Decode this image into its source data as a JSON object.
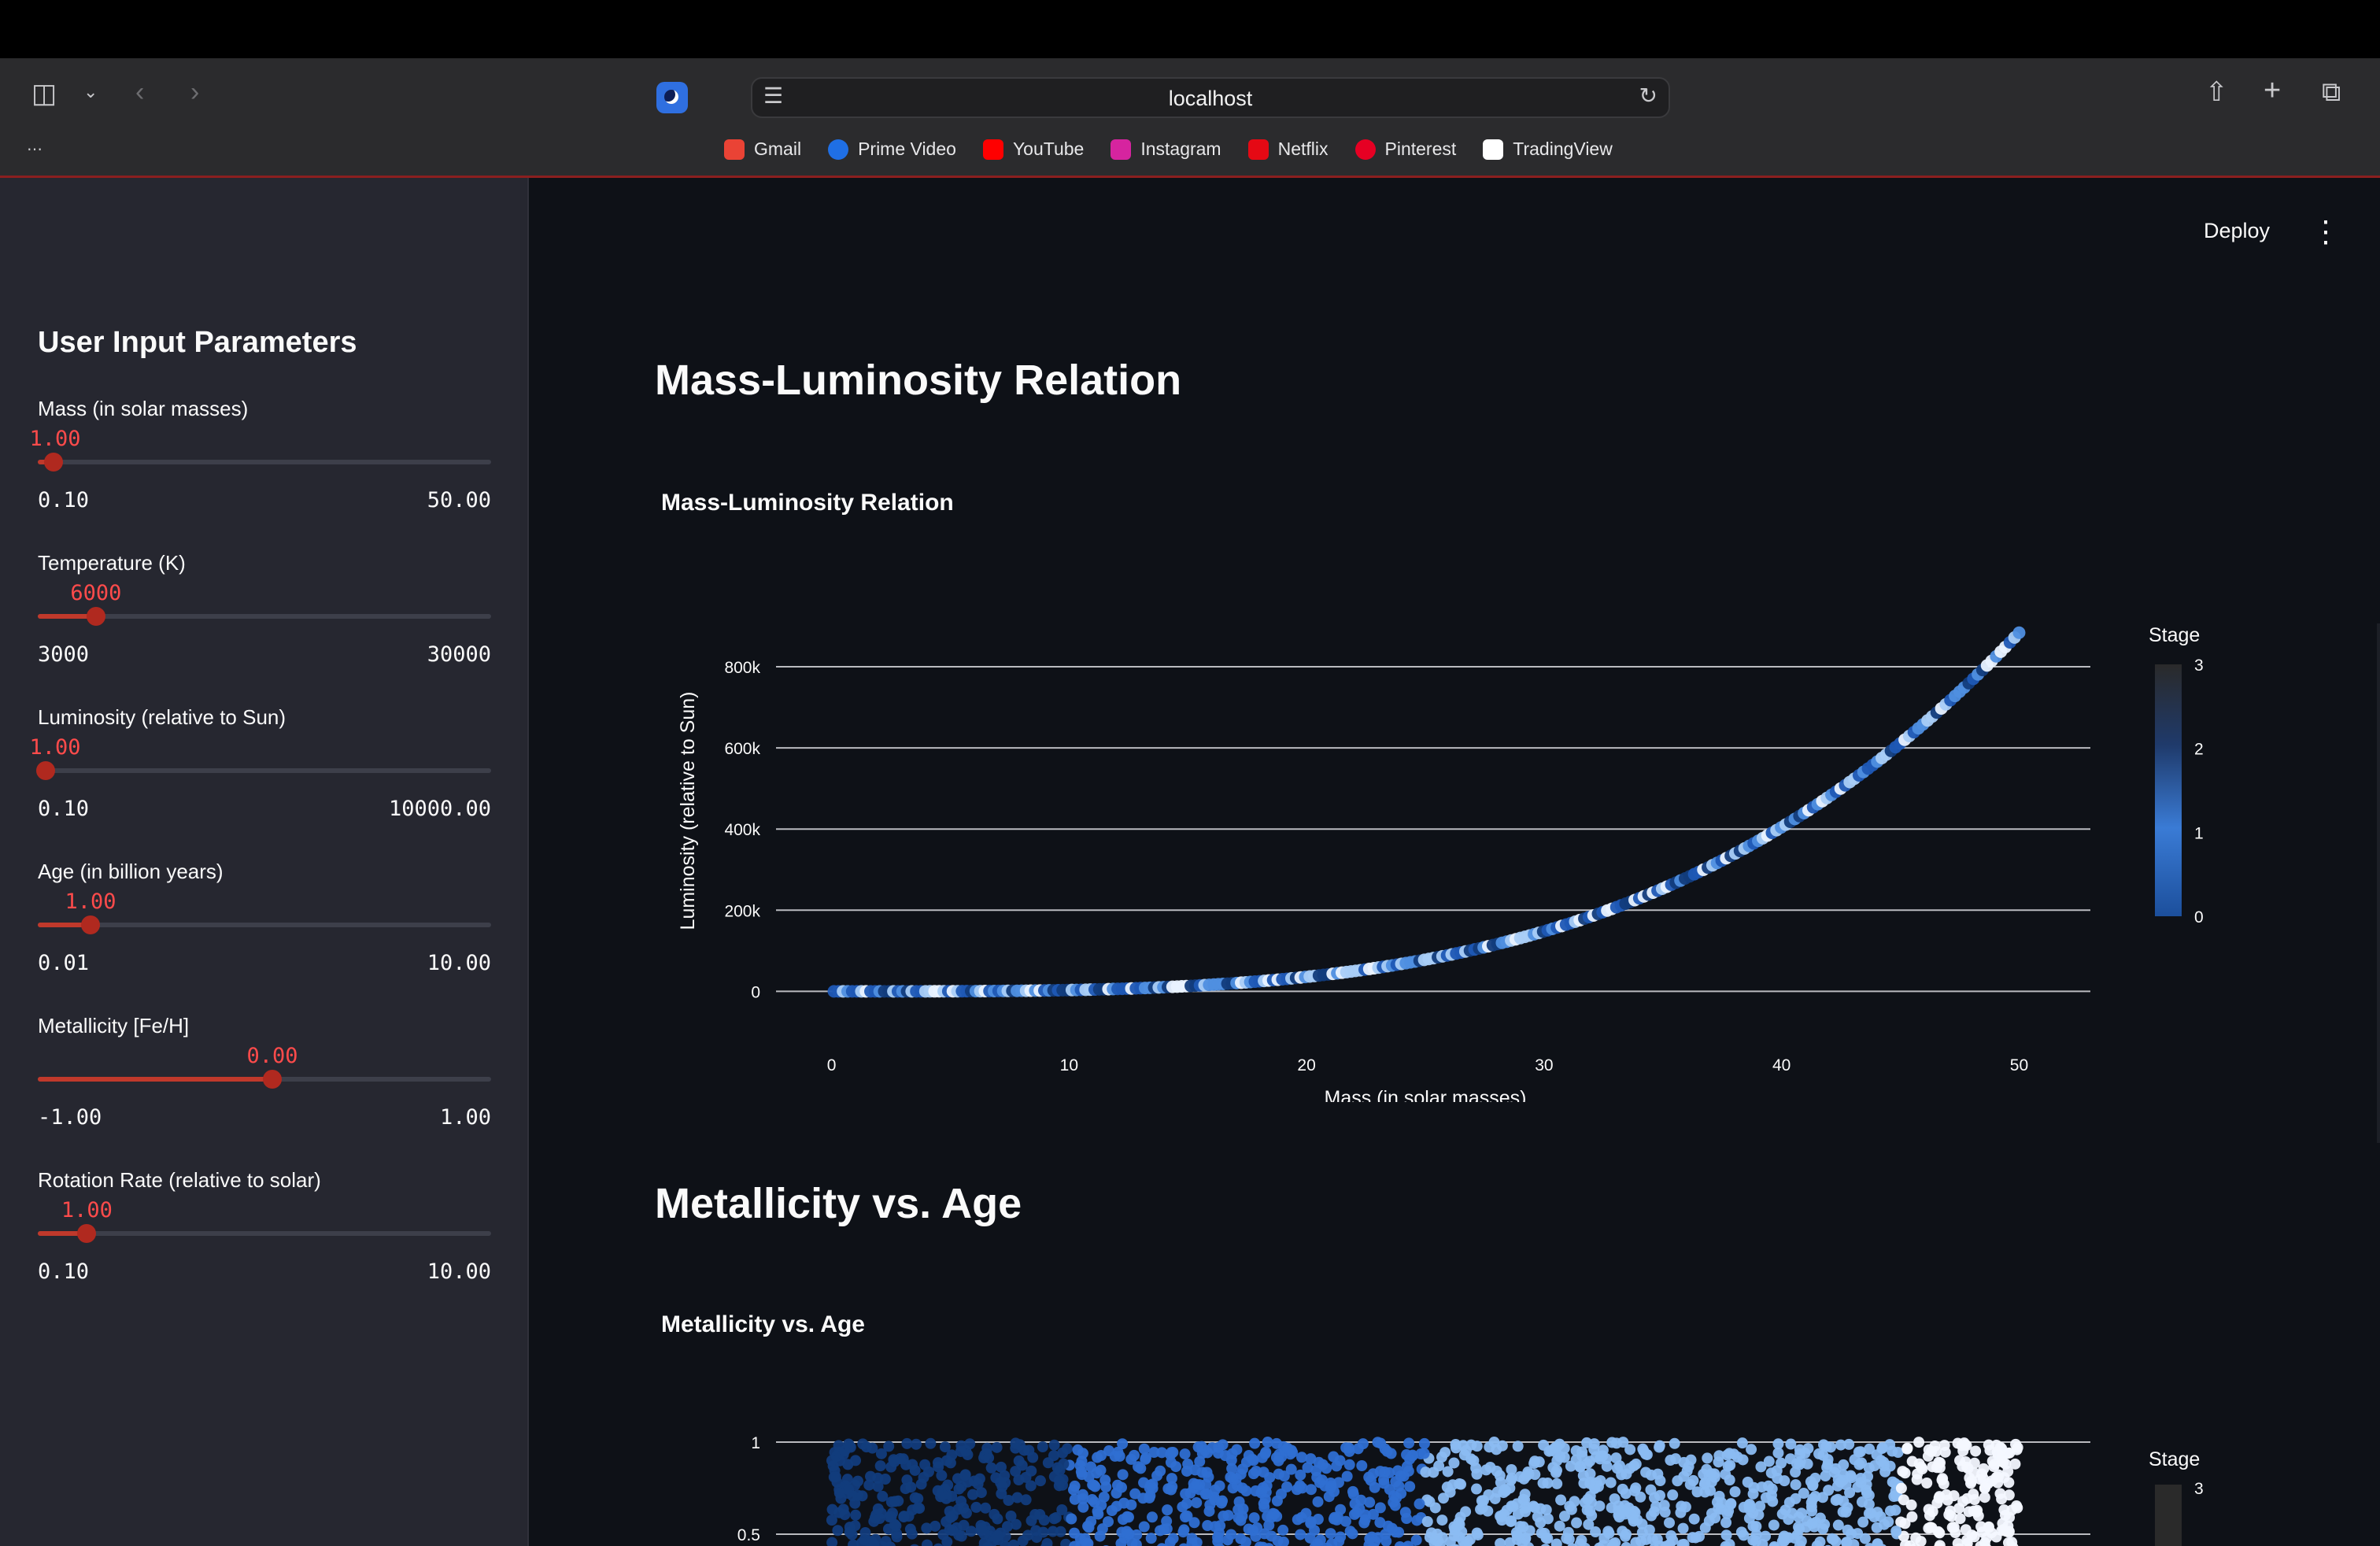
{
  "browser": {
    "url": "localhost",
    "bookmarks": [
      {
        "label": "Gmail",
        "color": "#ea4335"
      },
      {
        "label": "Prime Video",
        "color": "#1f6fe5"
      },
      {
        "label": "YouTube",
        "color": "#ff0000"
      },
      {
        "label": "Instagram",
        "color": "#d6249f"
      },
      {
        "label": "Netflix",
        "color": "#e50914"
      },
      {
        "label": "Pinterest",
        "color": "#e60023"
      },
      {
        "label": "TradingView",
        "color": "#ffffff"
      }
    ]
  },
  "toolbar": {
    "deploy_label": "Deploy"
  },
  "sidebar": {
    "title": "User Input Parameters",
    "sliders": [
      {
        "label": "Mass (in solar masses)",
        "value": "1.00",
        "min": "0.10",
        "max": "50.00",
        "fraction": 0.018
      },
      {
        "label": "Temperature (K)",
        "value": "6000",
        "min": "3000",
        "max": "30000",
        "fraction": 0.111
      },
      {
        "label": "Luminosity (relative to Sun)",
        "value": "1.00",
        "min": "0.10",
        "max": "10000.00",
        "fraction": 0.0001
      },
      {
        "label": "Age (in billion years)",
        "value": "1.00",
        "min": "0.01",
        "max": "10.00",
        "fraction": 0.099
      },
      {
        "label": "Metallicity [Fe/H]",
        "value": "0.00",
        "min": "-1.00",
        "max": "1.00",
        "fraction": 0.5
      },
      {
        "label": "Rotation Rate (relative to solar)",
        "value": "1.00",
        "min": "0.10",
        "max": "10.00",
        "fraction": 0.091
      }
    ]
  },
  "main": {
    "section1_heading": "Mass-Luminosity Relation",
    "section2_heading": "Metallicity vs. Age"
  },
  "chart_data": [
    {
      "type": "scatter",
      "title": "Mass-Luminosity Relation",
      "xlabel": "Mass (in solar masses)",
      "ylabel": "Luminosity (relative to Sun)",
      "xlim": [
        -3,
        53
      ],
      "ylim": [
        -40000,
        930000
      ],
      "x_ticks": [
        0,
        10,
        20,
        30,
        40,
        50
      ],
      "x_tick_labels": [
        "0",
        "10",
        "20",
        "30",
        "40",
        "50"
      ],
      "y_ticks": [
        0,
        200000,
        400000,
        600000,
        800000
      ],
      "y_tick_labels": [
        "0",
        "200k",
        "400k",
        "600k",
        "800k"
      ],
      "relation": "luminosity = mass^3.5",
      "x_range": [
        0.1,
        50
      ],
      "color_by": "Stage",
      "colorbar": {
        "title": "Stage",
        "ticks": [
          "0",
          "1",
          "2",
          "3"
        ],
        "colors": [
          "#1c4f9c",
          "#3a7bd5",
          "#1f3a6b",
          "#2a2a2a"
        ]
      },
      "grid": "horizontal",
      "legend": "right"
    },
    {
      "type": "scatter",
      "title": "Metallicity vs. Age",
      "xlim": [
        -3,
        53
      ],
      "ylim": [
        -1,
        1
      ],
      "y_ticks": [
        0.5,
        1
      ],
      "y_tick_labels": [
        "0.5",
        "1"
      ],
      "color_by": "Stage",
      "colorbar": {
        "title": "Stage",
        "ticks": [
          "3"
        ]
      },
      "grid": "horizontal",
      "legend": "right"
    }
  ]
}
